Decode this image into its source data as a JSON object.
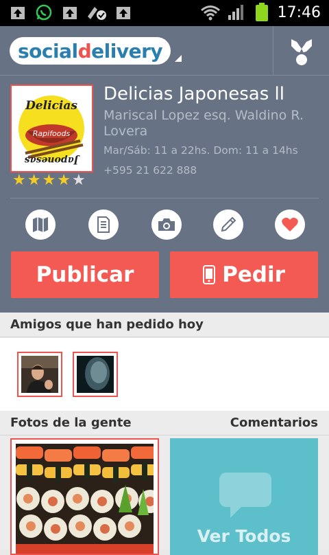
{
  "status_bar": {
    "time": "17:46",
    "icons": [
      "upload-notification-icon",
      "whatsapp-icon",
      "upload-notification-icon",
      "satellite-icon",
      "upload-notification-icon",
      "wifi-icon",
      "signal-icon",
      "battery-icon"
    ]
  },
  "app_bar": {
    "logo_part1": "social",
    "logo_part2": "d",
    "logo_part3": "elivery",
    "brand_colors": {
      "blue": "#2a7fae",
      "red": "#ef5350"
    }
  },
  "restaurant": {
    "name": "Delicias Japonesas ll",
    "address": "Mariscal Lopez esq. Waldino R. Lovera",
    "hours": "Mar/Sáb: 11 a 22hs.  Dom: 11 a 14hs",
    "phone": "+595 21 622 888",
    "logo_text_top": "Delicias",
    "logo_text_mid": "Rapifoods",
    "logo_text_bottom": "Japonesas",
    "rating": 4,
    "rating_max": 5
  },
  "actions": [
    "map-icon",
    "menu-document-icon",
    "camera-icon",
    "pencil-icon",
    "heart-icon"
  ],
  "buttons": {
    "publicar": "Publicar",
    "pedir": "Pedir"
  },
  "friends_section": {
    "title": "Amigos que han pedido hoy"
  },
  "photos_section": {
    "title": "Fotos de la gente",
    "comments_label": "Comentarios",
    "ver_todos": "Ver Todos"
  },
  "colors": {
    "header_bg": "#677384",
    "accent": "#f35a54",
    "comments_bg": "#5cbfca"
  }
}
